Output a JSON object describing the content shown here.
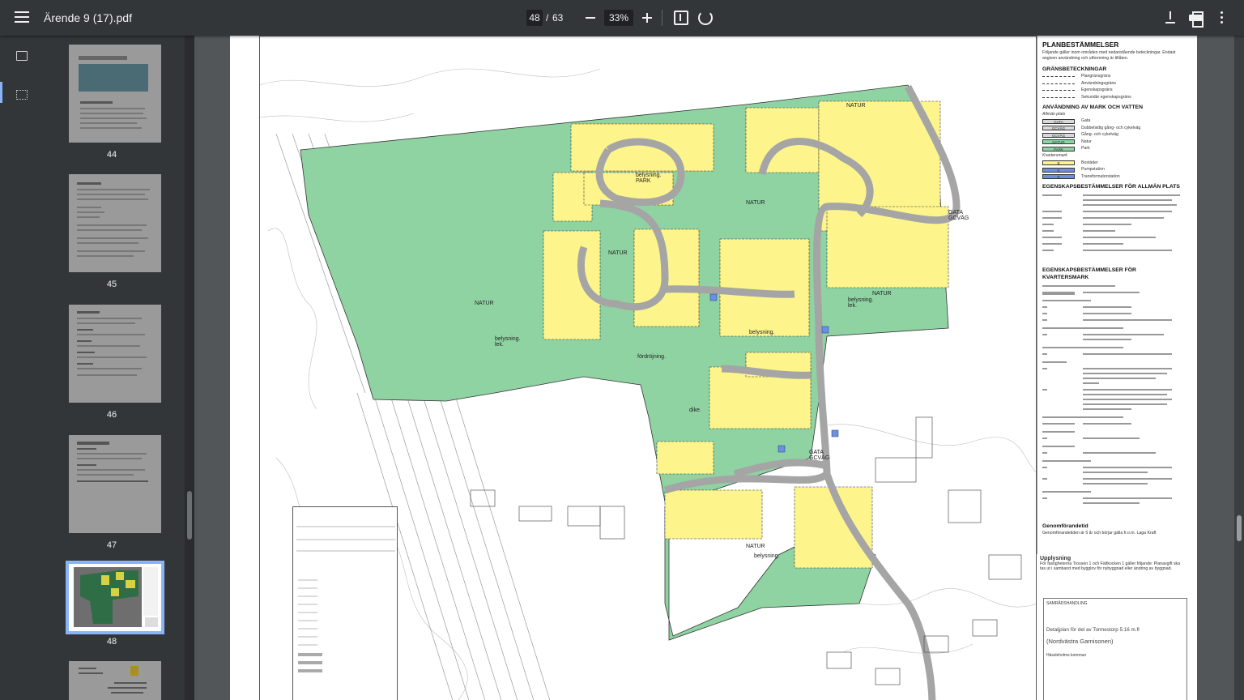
{
  "toolbar": {
    "file_name": "Ärende 9 (17).pdf",
    "current_page": "48",
    "page_separator": "/",
    "total_pages": "63",
    "zoom": "33%"
  },
  "thumbnails": [
    {
      "label": "44"
    },
    {
      "label": "45"
    },
    {
      "label": "46"
    },
    {
      "label": "47"
    },
    {
      "label": "48"
    }
  ],
  "plan": {
    "legend_title": "PLANBESTÄMMELSER",
    "legend_intro": "Följande gäller inom områden med nedanstående beteckningar. Endast angiven användning och utformning är tillåten.",
    "sec_grans": "GRÄNSBETECKNINGAR",
    "grans_items": [
      "Plangränsgräns",
      "Användningsgräns",
      "Egenskapsgräns",
      "Sekundär egenskapsgräns"
    ],
    "sec_anv": "ANVÄNDNING AV MARK OCH VATTEN",
    "sec_anv_sub": "Allmän plats",
    "anv_items": [
      {
        "code": "GATA",
        "desc": "Gata",
        "color": "#d9d9d9"
      },
      {
        "code": "GCVÄG",
        "desc": "Dubbelsidig gång- och cykelväg",
        "color": "#d9d9d9"
      },
      {
        "code": "GCVÄG",
        "desc": "Gång- och cykelväg",
        "color": "#d9d9d9"
      },
      {
        "code": "NATUR",
        "desc": "Natur",
        "color": "#8fd3a3"
      },
      {
        "code": "PARK",
        "desc": "Park",
        "color": "#8fd3a3"
      }
    ],
    "kvarter_sub": "Kvartersmark",
    "kvarter_items": [
      {
        "code": "B",
        "desc": "Bostäder",
        "color": "#fdf58c"
      },
      {
        "code": "E",
        "desc": "Pumpstation",
        "color": "#6e8fe0"
      },
      {
        "code": "E",
        "desc": "Transformatorstation",
        "color": "#6e8fe0"
      }
    ],
    "sec_egen_allm": "EGENSKAPSBESTÄMMELSER FÖR ALLMÄN PLATS",
    "sec_egen_kv": "EGENSKAPSBESTÄMMELSER FÖR KVARTERSMARK",
    "sec_genom": "Genomförandetid",
    "genom_text": "Genomförandetiden är 5 år och börjar gälla fr.o.m. Laga Kraft",
    "upplysning_title": "Upplysning",
    "upplysning_text": "För fastigheterna Trossen 1 och Fältkocken 1 gäller följande: Planavgift ska tas ut i samband med bygglov för nybyggnad eller ändring av byggnad.",
    "tb_samrad": "SAMRÅDSHANDLING",
    "tb_title": "Detaljplan för del av Tormestorp 5:16 m.fl",
    "tb_subtitle": "(Nordvästra Garnisonen)",
    "tb_kommun": "Hässleholms kommun",
    "map_labels": [
      "NATUR",
      "NATUR",
      "NATUR",
      "NATUR",
      "NATUR",
      "NATUR",
      "belysning. PARK",
      "GATA GCVÄG",
      "GATA GCVÄG",
      "belysning.",
      "belysning. lek.",
      "fördröjning.",
      "belysning. lek.",
      "dike.",
      "belysning."
    ]
  },
  "colors": {
    "toolbar": "#323639",
    "background": "#525659",
    "accent": "#8ab4f8",
    "natur": "#8fd3a3",
    "bostader": "#fdf58c"
  },
  "icons": {
    "menu": "menu-icon",
    "zoom_out": "minus-icon",
    "zoom_in": "plus-icon",
    "fit": "fit-to-page-icon",
    "rotate": "rotate-icon",
    "download": "download-icon",
    "print": "print-icon",
    "more": "more-vert-icon",
    "thumbnails": "thumbnails-icon",
    "outline": "outline-icon"
  }
}
